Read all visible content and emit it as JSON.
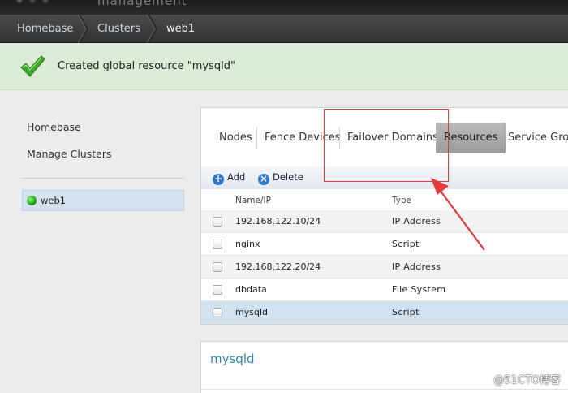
{
  "header": {
    "app_title": "management"
  },
  "breadcrumb": {
    "items": [
      "Homebase",
      "Clusters",
      "web1"
    ]
  },
  "notification": {
    "message": "Created global resource \"mysqld\""
  },
  "sidebar": {
    "links": [
      "Homebase",
      "Manage Clusters"
    ],
    "clusters": [
      {
        "name": "web1",
        "status": "online"
      }
    ]
  },
  "tabs": {
    "items": [
      "Nodes",
      "Fence Devices",
      "Failover Domains",
      "Resources",
      "Service Groups"
    ],
    "active": "Resources"
  },
  "toolbar": {
    "add_label": "Add",
    "delete_label": "Delete"
  },
  "table": {
    "columns": [
      "Name/IP",
      "Type"
    ],
    "rows": [
      {
        "name": "192.168.122.10/24",
        "type": "IP Address"
      },
      {
        "name": "nginx",
        "type": "Script"
      },
      {
        "name": "192.168.122.20/24",
        "type": "IP Address"
      },
      {
        "name": "dbdata",
        "type": "File System"
      },
      {
        "name": "mysqld",
        "type": "Script",
        "selected": true
      }
    ]
  },
  "detail": {
    "title": "mysqld"
  },
  "watermark": "@51CTO博客",
  "colors": {
    "annotation": "#e23b3b",
    "success_bg": "#dcebd6",
    "selected_row": "#d0e1ef",
    "link_blue": "#2f86b4"
  }
}
